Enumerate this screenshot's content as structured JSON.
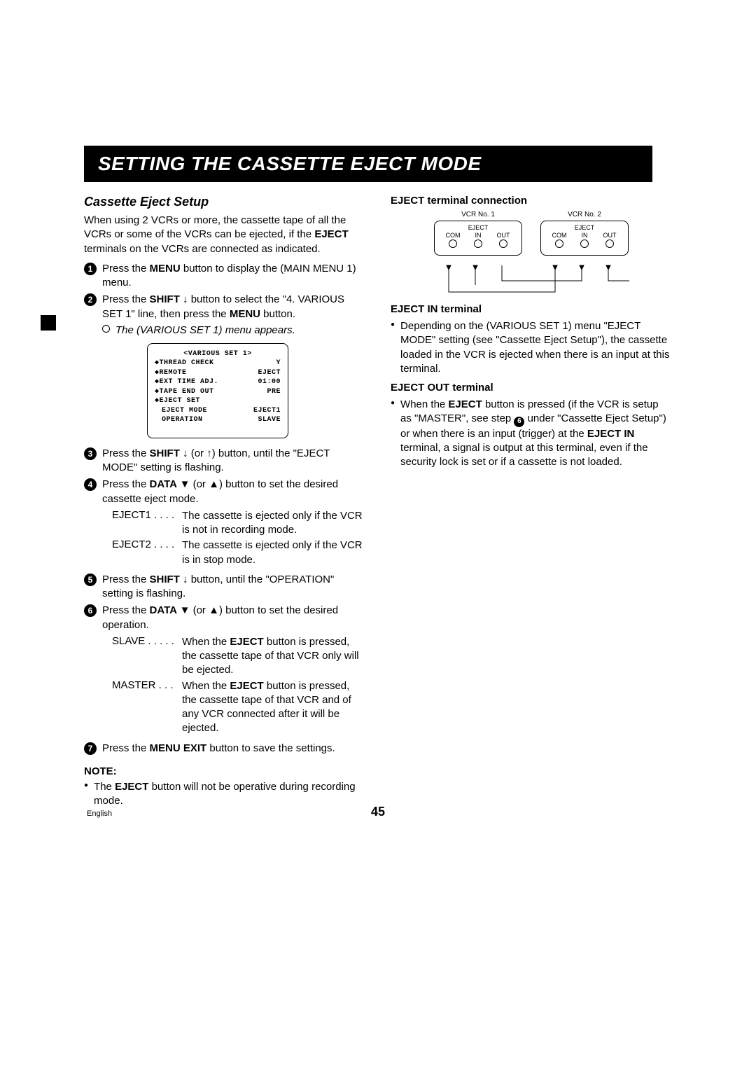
{
  "title": "SETTING THE CASSETTE EJECT MODE",
  "left": {
    "heading": "Cassette Eject Setup",
    "intro_a": "When using 2 VCRs or more, the cassette tape of all the VCRs or some of the VCRs can be ejected, if the ",
    "intro_bold": "EJECT",
    "intro_b": " terminals on the VCRs are connected as indicated.",
    "step1_a": "Press the ",
    "step1_bold": "MENU",
    "step1_b": " button to display the (MAIN MENU 1) menu.",
    "step2_a": "Press the ",
    "step2_bold": "SHIFT ↓",
    "step2_b": " button to select the \"4. VARIOUS SET 1\" line, then press the ",
    "step2_bold2": "MENU",
    "step2_c": " button.",
    "step2_sub": "The (VARIOUS SET 1) menu appears.",
    "menu": {
      "title": "<VARIOUS SET 1>",
      "rows": [
        {
          "l": "◆THREAD CHECK",
          "r": "Y"
        },
        {
          "l": "◆REMOTE",
          "r": "EJECT"
        },
        {
          "l": "◆EXT TIME ADJ.",
          "r": "01:00"
        },
        {
          "l": "◆TAPE END OUT",
          "r": "PRE"
        },
        {
          "l": "◆EJECT SET",
          "r": ""
        }
      ],
      "subrows": [
        {
          "l": "EJECT MODE",
          "r": "EJECT1"
        },
        {
          "l": "OPERATION",
          "r": "SLAVE"
        }
      ]
    },
    "step3_a": "Press the ",
    "step3_bold": "SHIFT ↓",
    "step3_mid": " (or ",
    "step3_bold2": "↑",
    "step3_b": ") button, until the \"EJECT MODE\" setting is flashing.",
    "step4_a": "Press the ",
    "step4_bold": "DATA ▼",
    "step4_mid": " (or ",
    "step4_bold2": "▲",
    "step4_b": ") button to set the desired cassette eject mode.",
    "def_eject1_l": "EJECT1 . . . .",
    "def_eject1_d": "The cassette is ejected only if the VCR is not in recording mode.",
    "def_eject2_l": "EJECT2 . . . .",
    "def_eject2_d": "The cassette is ejected only if the VCR is in stop mode.",
    "step5_a": "Press the ",
    "step5_bold": "SHIFT ↓",
    "step5_b": " button, until the \"OPERATION\" setting is flashing.",
    "step6_a": "Press the ",
    "step6_bold": "DATA ▼",
    "step6_mid": " (or ",
    "step6_bold2": "▲",
    "step6_b": ") button to set the desired operation.",
    "def_slave_l": "SLAVE . . . . .",
    "def_slave_d_a": "When the ",
    "def_slave_d_bold": "EJECT",
    "def_slave_d_b": " button is pressed, the cassette tape of that VCR only will be ejected.",
    "def_master_l": "MASTER . . .",
    "def_master_d_a": "When the ",
    "def_master_d_bold": "EJECT",
    "def_master_d_b": " button is pressed, the cassette tape of that VCR and of any VCR connected after it will be ejected.",
    "step7_a": "Press the ",
    "step7_bold": "MENU EXIT",
    "step7_b": " button to save the settings.",
    "note_head": "NOTE:",
    "note_a": "The ",
    "note_bold": "EJECT",
    "note_b": " button will not be operative during recording mode."
  },
  "right": {
    "conn_head": "EJECT terminal connection",
    "vcr1": "VCR No. 1",
    "vcr2": "VCR No. 2",
    "eject": "EJECT",
    "com": "COM",
    "in": "IN",
    "out": "OUT",
    "in_head": "EJECT IN terminal",
    "in_text": "Depending on the (VARIOUS SET 1) menu \"EJECT MODE\" setting (see \"Cassette Eject Setup\"), the cassette loaded in the VCR is ejected when there is an input at this terminal.",
    "out_head": "EJECT OUT terminal",
    "out_a": "When the ",
    "out_bold": "EJECT",
    "out_b": " button is pressed (if the VCR is setup as \"MASTER\", see step ",
    "out_c": " under \"Cassette Eject Setup\") or when there is an input (trigger) at the ",
    "out_bold2": "EJECT IN",
    "out_d": " terminal, a signal is output at this terminal, even if the security lock is set or if a cassette is not loaded."
  },
  "page_number": "45",
  "language": "English"
}
